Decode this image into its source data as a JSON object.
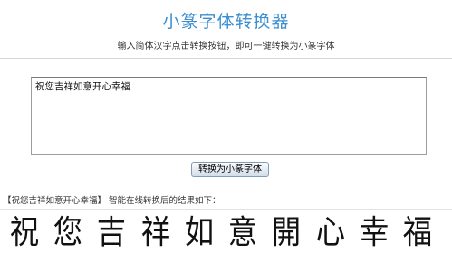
{
  "header": {
    "title": "小篆字体转换器",
    "subtitle": "输入简体汉字点击转换按钮，即可一键转换为小篆字体"
  },
  "input": {
    "value": "祝您吉祥如意开心幸福"
  },
  "convert_button": {
    "label": "转换为小篆字体"
  },
  "result": {
    "caption": "【祝您吉祥如意开心幸福】 智能在线转换后的结果如下：",
    "glyphs": [
      "祝",
      "您",
      "吉",
      "祥",
      "如",
      "意",
      "開",
      "心",
      "幸",
      "福"
    ]
  }
}
